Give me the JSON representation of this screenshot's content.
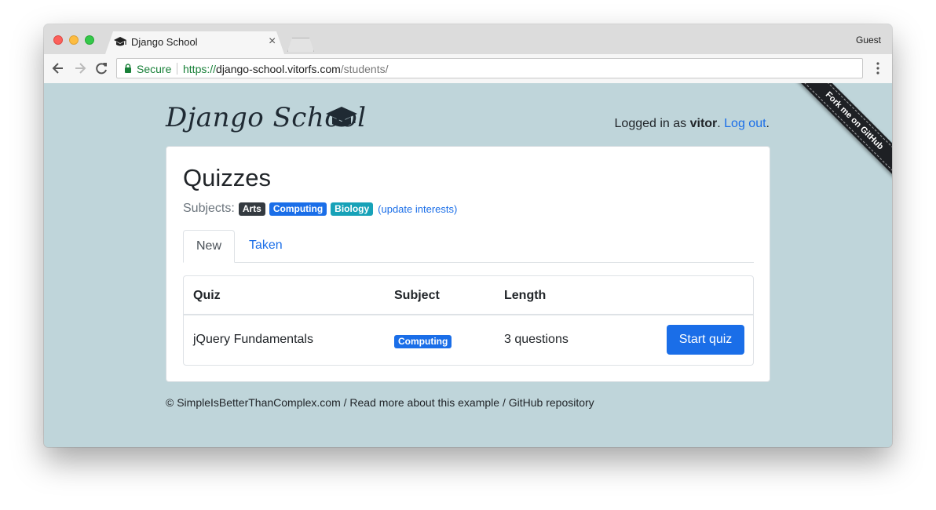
{
  "browser": {
    "tab_title": "Django School",
    "tab_close": "×",
    "profile": "Guest",
    "secure_label": "Secure",
    "url_scheme": "https://",
    "url_host": "django-school.vitorfs.com",
    "url_path": "/students/"
  },
  "header": {
    "brand": "Django School",
    "logged_in_prefix": "Logged in as ",
    "username": "vitor",
    "separator": ". ",
    "logout": "Log out",
    "suffix": "."
  },
  "ribbon": {
    "label": "Fork me on GitHub"
  },
  "main": {
    "title": "Quizzes",
    "subjects_label": "Subjects:",
    "subjects": [
      {
        "name": "Arts",
        "color": "#343a40"
      },
      {
        "name": "Computing",
        "color": "#1a6ee8"
      },
      {
        "name": "Biology",
        "color": "#17a2b8"
      }
    ],
    "update_interests": "(update interests)",
    "tabs": [
      {
        "label": "New",
        "active": true
      },
      {
        "label": "Taken",
        "active": false
      }
    ],
    "table": {
      "columns": [
        "Quiz",
        "Subject",
        "Length"
      ],
      "rows": [
        {
          "quiz": "jQuery Fundamentals",
          "subject": "Computing",
          "length": "3 questions",
          "action": "Start quiz"
        }
      ]
    }
  },
  "footer": {
    "copyright": "© SimpleIsBetterThanComplex.com",
    "sep1": " / ",
    "read_more": "Read more about this example",
    "sep2": " / ",
    "github": "GitHub repository"
  },
  "colors": {
    "page_background": "#bfd5da",
    "primary": "#1a6ee8",
    "secure_green": "#188038"
  }
}
